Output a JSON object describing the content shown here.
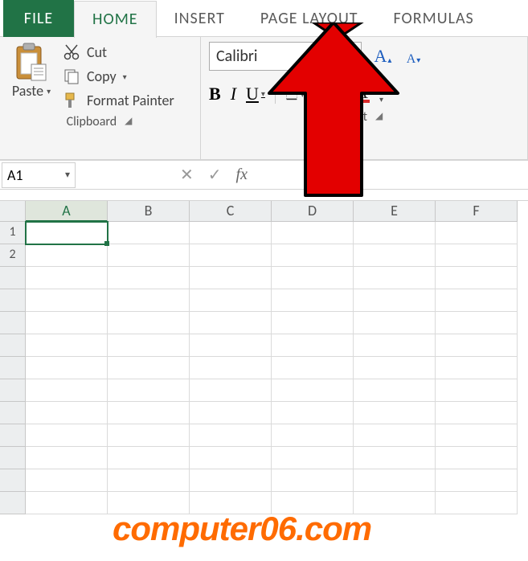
{
  "tabs": {
    "file": "FILE",
    "home": "HOME",
    "insert": "INSERT",
    "page_layout": "PAGE LAYOUT",
    "formulas": "FORMULAS"
  },
  "clipboard": {
    "paste": "Paste",
    "cut": "Cut",
    "copy": "Copy",
    "format_painter": "Format Painter",
    "group_label": "Clipboard"
  },
  "font": {
    "name": "Calibri",
    "group_label": "Font",
    "bold": "B",
    "italic": "I",
    "underline": "U",
    "font_color_letter": "A",
    "grow_letter": "A",
    "shrink_letter": "A"
  },
  "name_box": {
    "value": "A1"
  },
  "formula_bar": {
    "cancel": "✕",
    "confirm": "✓",
    "fx": "fx",
    "value": ""
  },
  "columns": [
    "A",
    "B",
    "C",
    "D",
    "E",
    "F"
  ],
  "rows": [
    "1",
    "2"
  ],
  "selected_cell": "A1",
  "watermark": "computer06.com"
}
